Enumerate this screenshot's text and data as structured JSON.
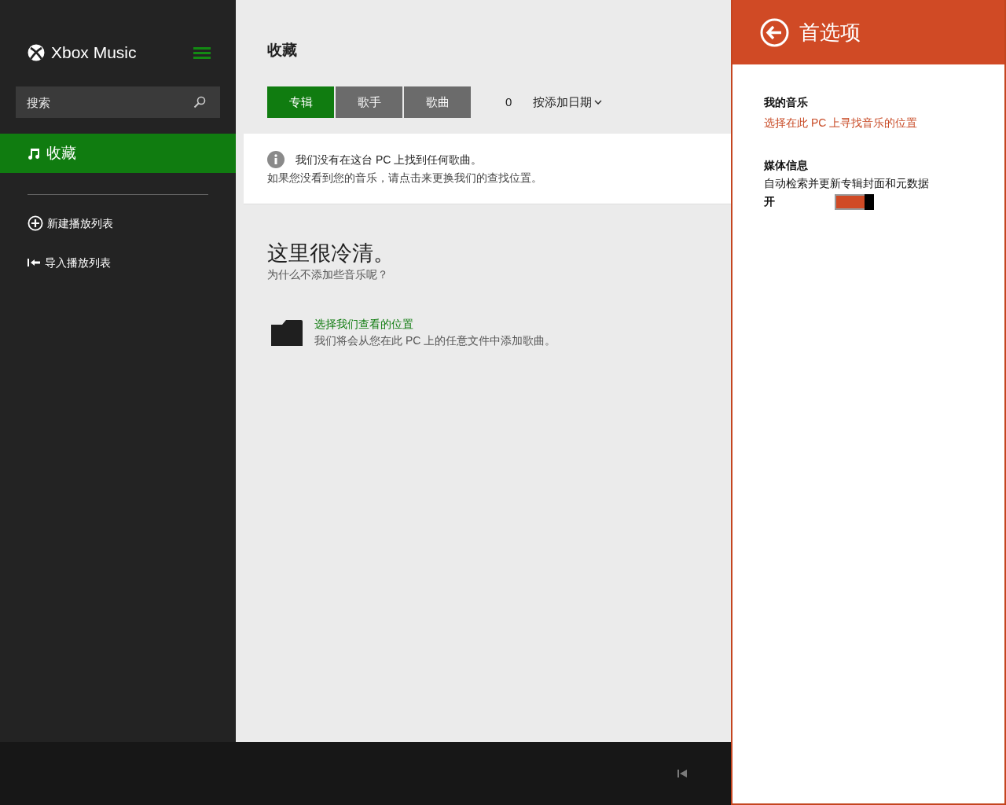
{
  "sidebar": {
    "app_title": "Xbox Music",
    "search": {
      "placeholder": "搜索"
    },
    "nav_items": [
      {
        "kind": "music",
        "label": "收藏",
        "selected": true
      }
    ],
    "actions": [
      {
        "kind": "add",
        "label": "新建播放列表"
      },
      {
        "kind": "import",
        "label": "导入播放列表"
      }
    ]
  },
  "collection": {
    "title": "收藏",
    "tabs": [
      {
        "label": "专辑",
        "selected": true
      },
      {
        "label": "歌手",
        "selected": false
      },
      {
        "label": "歌曲",
        "selected": false
      }
    ],
    "count": "0",
    "sort": "按添加日期",
    "notice": {
      "title": "我们没有在这台 PC 上找到任何歌曲。",
      "body": "如果您没看到您的音乐，请点击来更换我们的查找位置。"
    },
    "empty": {
      "heading": "这里很冷清。",
      "subheading": "为什么不添加些音乐呢？"
    },
    "add_location": {
      "link": "选择我们查看的位置",
      "description": "我们将会从您在此 PC 上的任意文件中添加歌曲。"
    }
  },
  "settings_panel": {
    "title": "首选项",
    "sections": [
      {
        "kind": "link",
        "heading": "我的音乐",
        "link": "选择在此 PC 上寻找音乐的位置"
      },
      {
        "kind": "toggle",
        "heading": "媒体信息",
        "description": "自动检索并更新专辑封面和元数据",
        "state_label": "开",
        "on": true
      }
    ]
  }
}
